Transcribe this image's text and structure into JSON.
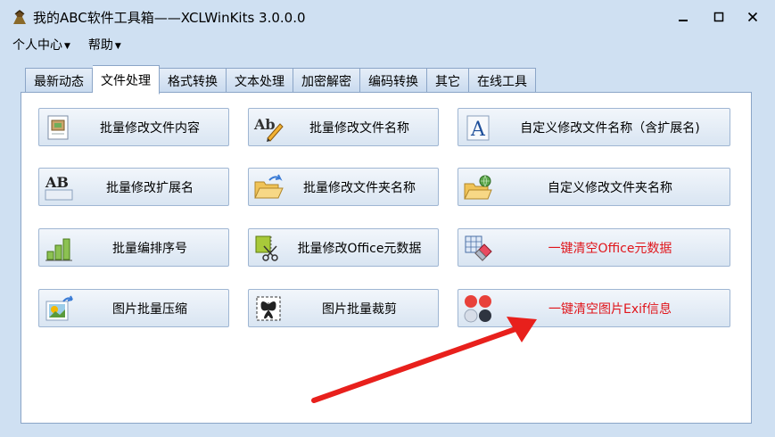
{
  "window": {
    "title": "我的ABC软件工具箱——XCLWinKits  3.0.0.0"
  },
  "menu": [
    {
      "label": "个人中心"
    },
    {
      "label": "帮助"
    }
  ],
  "tabs": [
    {
      "label": "最新动态"
    },
    {
      "label": "文件处理"
    },
    {
      "label": "格式转换"
    },
    {
      "label": "文本处理"
    },
    {
      "label": "加密解密"
    },
    {
      "label": "编码转换"
    },
    {
      "label": "其它"
    },
    {
      "label": "在线工具"
    }
  ],
  "active_tab": "文件处理",
  "buttons": [
    {
      "label": "批量修改文件内容",
      "icon": "document-image-icon"
    },
    {
      "label": "批量修改文件名称",
      "icon": "text-pencil-icon"
    },
    {
      "label": "自定义修改文件名称（含扩展名)",
      "icon": "letter-a-icon"
    },
    {
      "label": "批量修改扩展名",
      "icon": "ab-icon"
    },
    {
      "label": "批量修改文件夹名称",
      "icon": "folder-arrow-icon"
    },
    {
      "label": "自定义修改文件夹名称",
      "icon": "folder-globe-icon"
    },
    {
      "label": "批量编排序号",
      "icon": "bar-chart-icon"
    },
    {
      "label": "批量修改Office元数据",
      "icon": "scissors-doc-icon"
    },
    {
      "label": "一键清空Office元数据",
      "icon": "eraser-table-icon",
      "color": "#e0151b"
    },
    {
      "label": "图片批量压缩",
      "icon": "picture-arrow-icon"
    },
    {
      "label": "图片批量裁剪",
      "icon": "crop-butterfly-icon"
    },
    {
      "label": "一键清空图片Exif信息",
      "icon": "four-circles-icon",
      "color": "#e0151b"
    }
  ],
  "colors": {
    "window_bg": "#cfe0f2",
    "accent_red": "#e0151b"
  }
}
